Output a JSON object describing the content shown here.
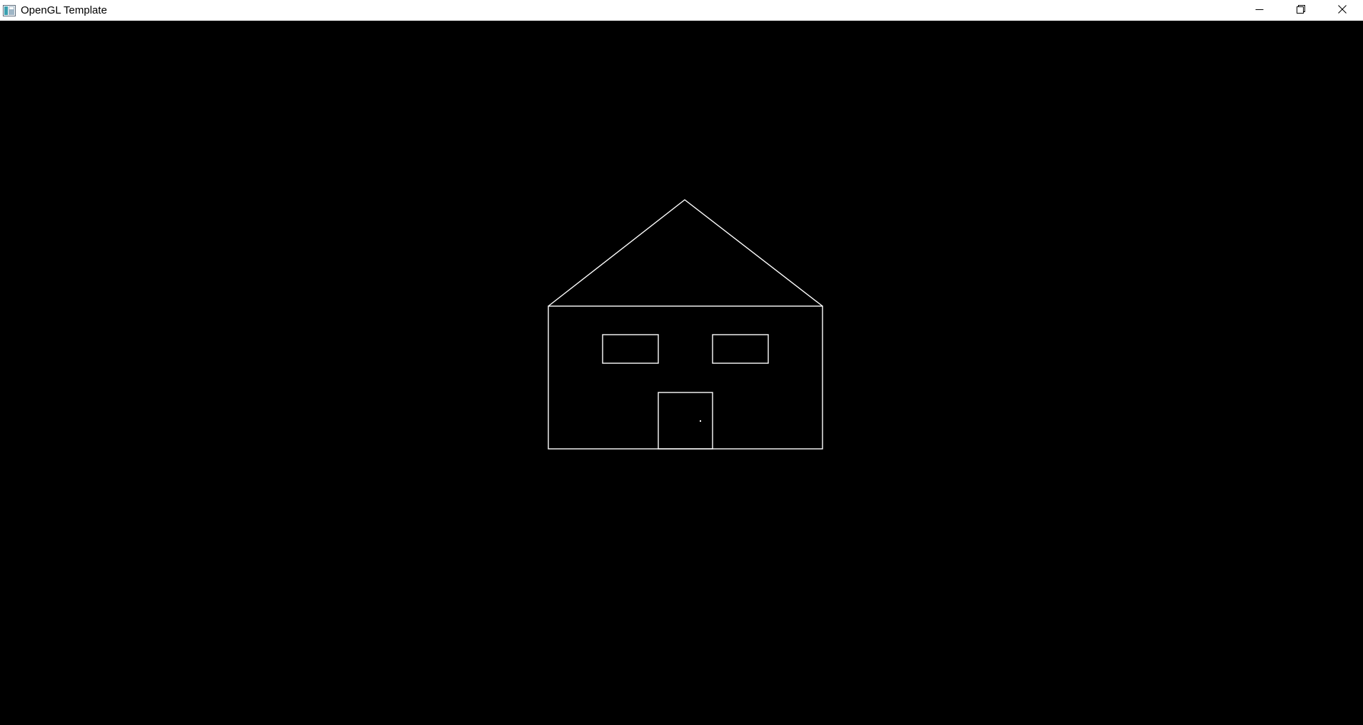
{
  "window": {
    "title": "OpenGL Template",
    "app_icon": "window-app-icon",
    "controls": {
      "minimize_icon": "minimize-icon",
      "restore_icon": "restore-icon",
      "close_icon": "close-icon"
    }
  },
  "scene": {
    "background_color": "#000000",
    "line_color": "#ffffff",
    "objects": [
      "roof",
      "house-body",
      "left-window",
      "right-window",
      "door",
      "door-knob"
    ]
  }
}
